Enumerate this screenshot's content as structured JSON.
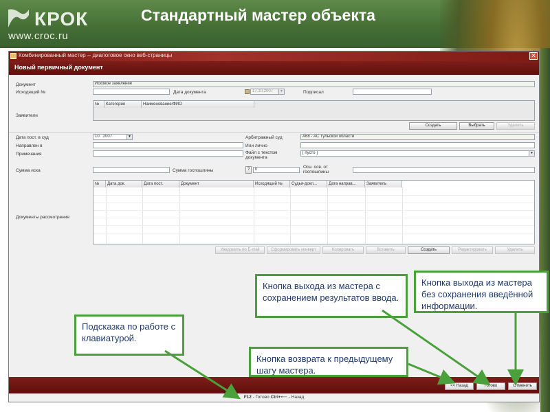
{
  "slide": {
    "title": "Стандартный мастер объекта",
    "logo": {
      "brand": "КРОК",
      "url": "www.croc.ru"
    },
    "colors": {
      "header_green": "#456f36",
      "window_red": "#7e1e1a",
      "callout_border": "#4aa03a",
      "callout_text": "#1e3a6e"
    }
  },
  "window": {
    "titlebar_text": "Комбинированный мастер -- диалоговое окно веб-страницы",
    "close_icon": "close-icon",
    "header": "Новый первичный документ"
  },
  "form": {
    "document_label": "Документ",
    "document_value": "Исковое заявление",
    "outgoing_label": "Исходящий №",
    "outgoing_value": "",
    "doc_date_label": "Дата документа",
    "doc_date_value": "17.10.2007",
    "signed_label": "Подписал",
    "signed_value": "",
    "applicants_label": "Заявители",
    "applicants_columns": [
      "№",
      "Категория",
      "Наименование/ФИО"
    ],
    "applicants_buttons": {
      "create": "Создать",
      "choose": "Выбрать",
      "delete": "Удалить"
    },
    "court_date_label": "Дата пост. в суд",
    "court_date_value": "10.    .2007",
    "arbitration_label": "Арбитражный суд",
    "arbitration_value": "А68 - АС Тульской области",
    "sent_to_label": "Направлен в",
    "sent_to_value": "",
    "in_person_label": "Или лично",
    "in_person_value": "",
    "notes_label": "Примечания",
    "notes_value": "",
    "text_file_label": "Файл с текстом документа",
    "text_file_value": "[ пусто ]",
    "claim_sum_label": "Сумма иска",
    "claim_sum_value": "",
    "duty_label": "Сумма госпошлины",
    "duty_help": "?",
    "duty_value": "0",
    "grounds_label": "Осн. осв. от госпошлины",
    "grounds_value": "",
    "review_label": "Документы рассмотрения",
    "review_columns": [
      "№",
      "Дата док.",
      "Дата пост.",
      "Документ",
      "Исходящий №",
      "Судья-докл...",
      "Дата направ...",
      "Заявитель"
    ],
    "review_buttons": {
      "email": "Уведомить по E-mail",
      "envelope": "Сформировать конверт",
      "copy": "Копировать",
      "paste": "Вставить",
      "create": "Создать",
      "edit": "Редактировать",
      "delete": "Удалить"
    }
  },
  "nav": {
    "back": "<< Назад",
    "done": "Готово",
    "cancel": "Отменить",
    "status_f12": "F12",
    "status_done": " - Готово ",
    "status_ctrl": "Ctrl+",
    "status_back_icon": "back-arrow-icon",
    "status_back": " - Назад"
  },
  "callouts": {
    "save_exit": "Кнопка выхода из мастера с сохранением результатов ввода.",
    "nosave_exit": "Кнопка выхода из мастера без сохранения введённой информации.",
    "keyboard_hint": "Подсказка по работе с клавиатурой.",
    "back_hint": "Кнопка возврата к предыдущему шагу мастера."
  }
}
